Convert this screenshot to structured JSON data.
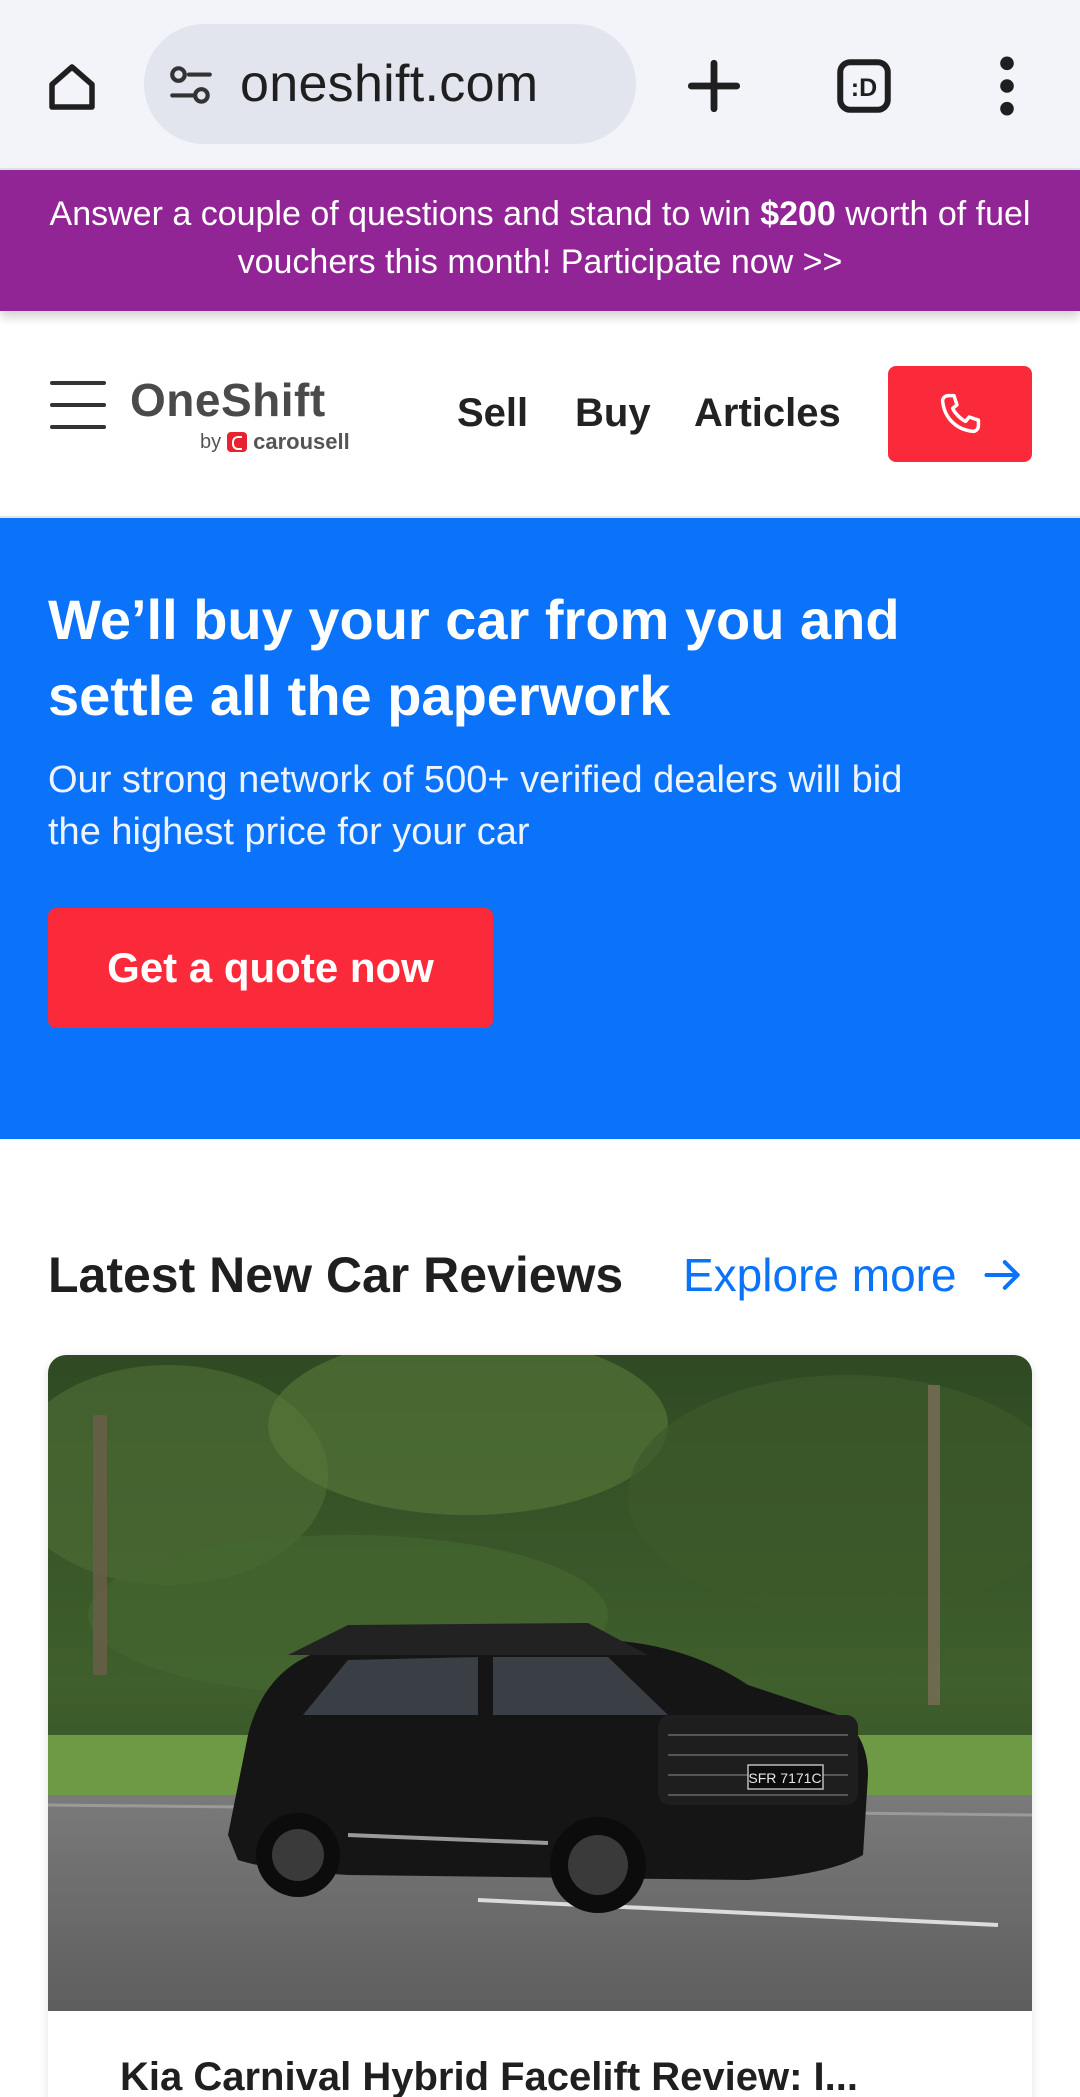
{
  "browser": {
    "url": "oneshift.com",
    "icons": {
      "home": "home-icon",
      "site_settings": "tune-icon",
      "new_tab": "plus-icon",
      "tabs": "tab-switcher-icon",
      "menu": "more-vert-icon"
    },
    "tab_switcher_label": ":D"
  },
  "promo": {
    "text_before": "Answer a couple of questions and stand to win ",
    "bold": "$200",
    "text_after": " worth of fuel vouchers this month! Participate now >>",
    "background": "#922595"
  },
  "header": {
    "logo": "OneShift",
    "logo_by": "by",
    "logo_brand": "carousell",
    "nav": [
      "Sell",
      "Buy",
      "Articles"
    ],
    "call_icon": "phone-icon",
    "call_button_color": "#fb2a3b"
  },
  "hero": {
    "title": "We’ll buy your car from you and settle all the paperwork",
    "subtitle": "Our strong network of 500+ verified dealers will bid the highest price for your car",
    "cta": "Get a quote now",
    "background": "#0a73f9"
  },
  "reviews": {
    "title": "Latest New Car Reviews",
    "explore": "Explore more",
    "explore_icon": "arrow-right-icon",
    "card": {
      "plate": "SFR 7171C",
      "title": "Kia Carnival Hybrid Facelift Review: I..."
    }
  }
}
